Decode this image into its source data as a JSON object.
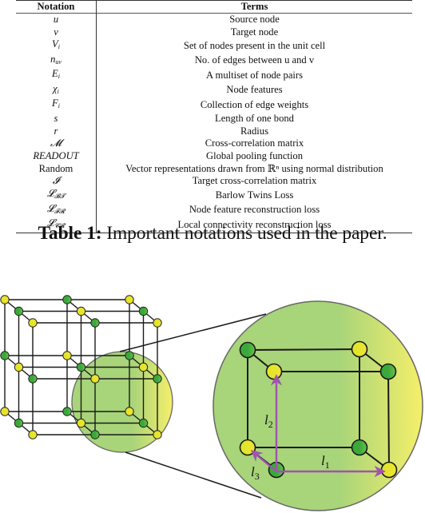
{
  "table": {
    "headers": [
      "Notation",
      "Terms"
    ],
    "rows": [
      {
        "notation": "u",
        "term": "Source node"
      },
      {
        "notation": "v",
        "term": "Target node"
      },
      {
        "notation": "V_i",
        "term": "Set of nodes present in the unit cell"
      },
      {
        "notation": "n_uv",
        "term": "No. of edges between u and v"
      },
      {
        "notation": "E_i",
        "term": "A multiset of node pairs"
      },
      {
        "notation": "χ_i",
        "term": "Node features"
      },
      {
        "notation": "F_i",
        "term": "Collection of edge weights"
      },
      {
        "notation": "s",
        "term": "Length of one bond"
      },
      {
        "notation": "r",
        "term": "Radius"
      },
      {
        "notation": "𝓜",
        "term": "Cross-correlation matrix"
      },
      {
        "notation": "READOUT",
        "term": "Global pooling function"
      },
      {
        "notation": "Random",
        "term": "Vector representations drawn from ℝⁿ using normal distribution"
      },
      {
        "notation": "𝓘",
        "term": "Target cross-correlation matrix"
      },
      {
        "notation": "𝓛_𝓑𝓣",
        "term": "Barlow Twins Loss"
      },
      {
        "notation": "𝓛_𝓕𝓡",
        "term": "Node feature reconstruction loss"
      },
      {
        "notation": "𝓛_𝓒𝓡",
        "term": "Local connectivity reconstruction loss"
      }
    ]
  },
  "caption": {
    "label": "Table 1:",
    "text": " Important notations used in the paper."
  },
  "figure": {
    "colors": {
      "node_yellow": "#e6e62c",
      "node_green": "#3fae3f",
      "lens_green": "#a8d47a",
      "lens_yellow": "#f5ef6a",
      "arrow_purple": "#a054b0",
      "edge": "#1a1a1a"
    },
    "arrow_labels": {
      "l1": "l",
      "l1_sub": "1",
      "l2": "l",
      "l2_sub": "2",
      "l3": "l",
      "l3_sub": "3"
    }
  }
}
